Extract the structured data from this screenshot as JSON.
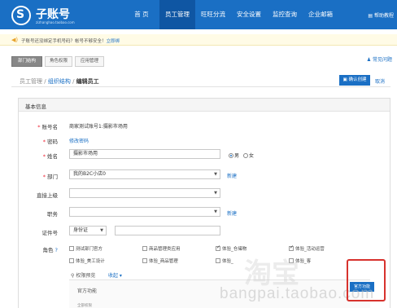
{
  "header": {
    "logo_glyph": "S",
    "title": "子账号",
    "subtitle": "zizhanghao.taobao.com",
    "nav": [
      {
        "label": "首 页",
        "active": false
      },
      {
        "label": "员工管理",
        "active": true
      },
      {
        "label": "旺旺分流",
        "active": false
      },
      {
        "label": "安全设置",
        "active": false
      },
      {
        "label": "监控查询",
        "active": false
      },
      {
        "label": "企业邮箱",
        "active": false
      }
    ],
    "help": "帮助教程"
  },
  "notice": {
    "text": "子账号还没绑定手机号码？帐号不够安全！",
    "link": "立即绑"
  },
  "tabs": [
    "部门结构",
    "角色权限",
    "应用管理"
  ],
  "faq": "常见问题",
  "breadcrumb": {
    "item1": "员工管理",
    "item2": "组织结构",
    "current": "编辑员工",
    "sep": "/"
  },
  "actions": {
    "confirm": "确认创建",
    "cancel": "取消"
  },
  "form": {
    "section_title": "基本信息",
    "account_label": "账号名",
    "account_value": "商家测试账号1:摄影市场用",
    "password_label": "密码",
    "password_link": "修改密码",
    "name_label": "姓名",
    "name_value": "摄影市场用",
    "gender_male": "男",
    "gender_female": "女",
    "dept_label": "部门",
    "dept_value": "我的B2C小店0",
    "dept_new": "新建",
    "supervisor_label": "直接上级",
    "position_label": "职务",
    "position_new": "新建",
    "id_label": "证件号",
    "id_type": "身份证",
    "role_label": "角色",
    "role_help": "?",
    "roles": [
      {
        "label": "测试部门官方",
        "checked": false
      },
      {
        "label": "商品管理类应用",
        "checked": false
      },
      {
        "label": "体验_仓储物",
        "checked": true
      },
      {
        "label": "体验_活动运营",
        "checked": true
      },
      {
        "label": "体验_美工设计",
        "checked": false
      },
      {
        "label": "体验_商品管理",
        "checked": false
      },
      {
        "label": "体验_",
        "checked": false
      },
      {
        "label": "体验_客",
        "checked": false
      }
    ],
    "perm_preview": "权限预览",
    "collapse": "收起",
    "official_title": "官方功能",
    "official_sub": "全部权限"
  },
  "watermark": "bangpai.taobao.com",
  "watermark2": "淘宝"
}
